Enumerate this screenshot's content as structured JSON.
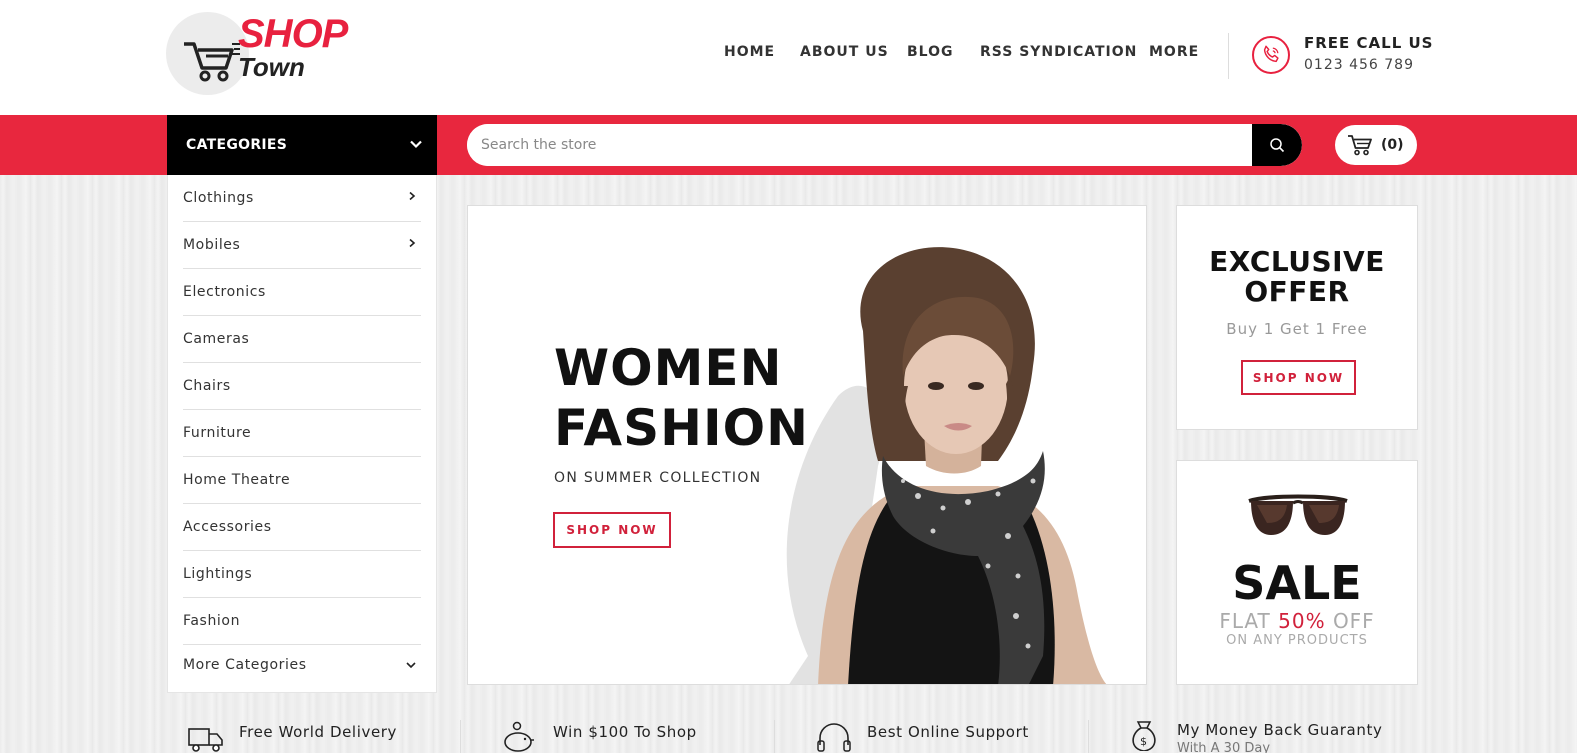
{
  "brand": {
    "name_top": "SHOP",
    "name_bottom": "Town",
    "accent": "#e8213f"
  },
  "nav": [
    {
      "label": "HOME"
    },
    {
      "label": "ABOUT US"
    },
    {
      "label": "BLOG"
    },
    {
      "label": "RSS SYNDICATION"
    },
    {
      "label": "MORE"
    }
  ],
  "contact": {
    "title": "FREE CALL US",
    "phone": "0123 456 789",
    "icon": "phone-icon"
  },
  "categories": {
    "heading": "CATEGORIES",
    "items": [
      {
        "label": "Clothings",
        "has_submenu": true
      },
      {
        "label": "Mobiles",
        "has_submenu": true
      },
      {
        "label": "Electronics",
        "has_submenu": false
      },
      {
        "label": "Cameras",
        "has_submenu": false
      },
      {
        "label": "Chairs",
        "has_submenu": false
      },
      {
        "label": "Furniture",
        "has_submenu": false
      },
      {
        "label": "Home Theatre",
        "has_submenu": false
      },
      {
        "label": "Accessories",
        "has_submenu": false
      },
      {
        "label": "Lightings",
        "has_submenu": false
      },
      {
        "label": "Fashion",
        "has_submenu": false
      },
      {
        "label": "More Categories",
        "expandable": true
      }
    ]
  },
  "search": {
    "placeholder": "Search the store",
    "value": ""
  },
  "cart": {
    "count": "(0)"
  },
  "banner": {
    "title_line1": "WOMEN",
    "title_line2": "FASHION",
    "subtitle": "ON SUMMER COLLECTION",
    "button": "SHOP NOW"
  },
  "offer": {
    "title_line1": "EXCLUSIVE",
    "title_line2": "OFFER",
    "subtitle": "Buy 1 Get 1 Free",
    "button": "SHOP NOW"
  },
  "sale": {
    "title": "SALE",
    "flat_prefix": "FLAT",
    "percent": "50%",
    "flat_suffix": "OFF",
    "note": "ON ANY PRODUCTS"
  },
  "features": [
    {
      "title": "Free World Delivery",
      "subtitle": "",
      "icon": "truck-icon"
    },
    {
      "title": "Win $100 To Shop",
      "subtitle": "",
      "icon": "piggy-bank-icon"
    },
    {
      "title": "Best Online Support",
      "subtitle": "",
      "icon": "headset-icon"
    },
    {
      "title": "My Money Back Guaranty",
      "subtitle": "With A 30 Day",
      "icon": "money-bag-icon"
    }
  ]
}
